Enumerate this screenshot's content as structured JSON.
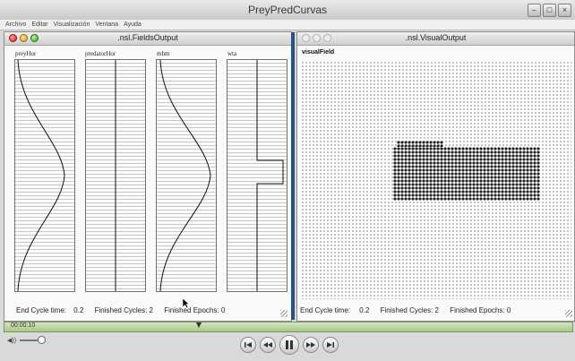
{
  "app": {
    "title": "PreyPredCurvas"
  },
  "menu": [
    "Archivo",
    "Editar",
    "Visualización",
    "Ventana",
    "Ayuda"
  ],
  "fields_window": {
    "title": ".nsl.FieldsOutput",
    "plots": [
      {
        "label": "preyHor"
      },
      {
        "label": "predatorHor"
      },
      {
        "label": "mhm"
      },
      {
        "label": "wta"
      }
    ],
    "status": {
      "cycle_label": "End Cycle time:",
      "cycle_value": "0.2",
      "finished_cycles_label": "Finished Cycles:",
      "finished_cycles_value": "2",
      "finished_epochs_label": "Finished Epochs:",
      "finished_epochs_value": "0"
    }
  },
  "visual_window": {
    "title": ".nsl.VisualOutput",
    "field_label": "visualField",
    "status": {
      "cycle_label": "End Cycle time:",
      "cycle_value": "0.2",
      "finished_cycles_label": "Finished Cycles:",
      "finished_cycles_value": "2",
      "finished_epochs_label": "Finished Epochs:",
      "finished_epochs_value": "0"
    }
  },
  "player": {
    "time": "00:00:10",
    "buttons": [
      "skip-start",
      "rewind",
      "pause",
      "fast-forward",
      "skip-end"
    ]
  },
  "colors": {
    "divider": "#2c4f86",
    "timeline": "#b8d49a",
    "grid_dot": "#b4b4b4",
    "blob": "#222222"
  }
}
